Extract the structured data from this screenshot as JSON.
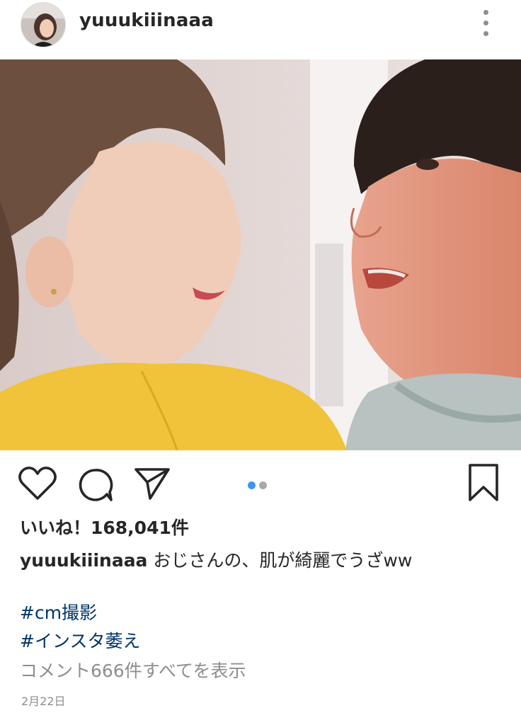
{
  "post": {
    "username": "yuuukiiinaaa",
    "likes_text": "いいね！168,041件",
    "caption_user": "yuuukiiinaaa",
    "caption_text": " おじさんの、肌が綺麗でうざww",
    "hashtags": [
      "#cm撮影",
      "#インスタ萎え"
    ],
    "view_comments": "コメント666件すべてを表示",
    "date": "2月22日"
  },
  "carousel": {
    "count": 2,
    "active_index": 0
  },
  "icons": {
    "more": "more-vertical-icon",
    "like": "heart-icon",
    "comment": "comment-bubble-icon",
    "share": "paper-plane-icon",
    "save": "bookmark-icon"
  },
  "colors": {
    "active_dot": "#3897f0",
    "inactive_dot": "#a8a8a8",
    "hashtag": "#003569",
    "muted": "#8e8e8e"
  }
}
